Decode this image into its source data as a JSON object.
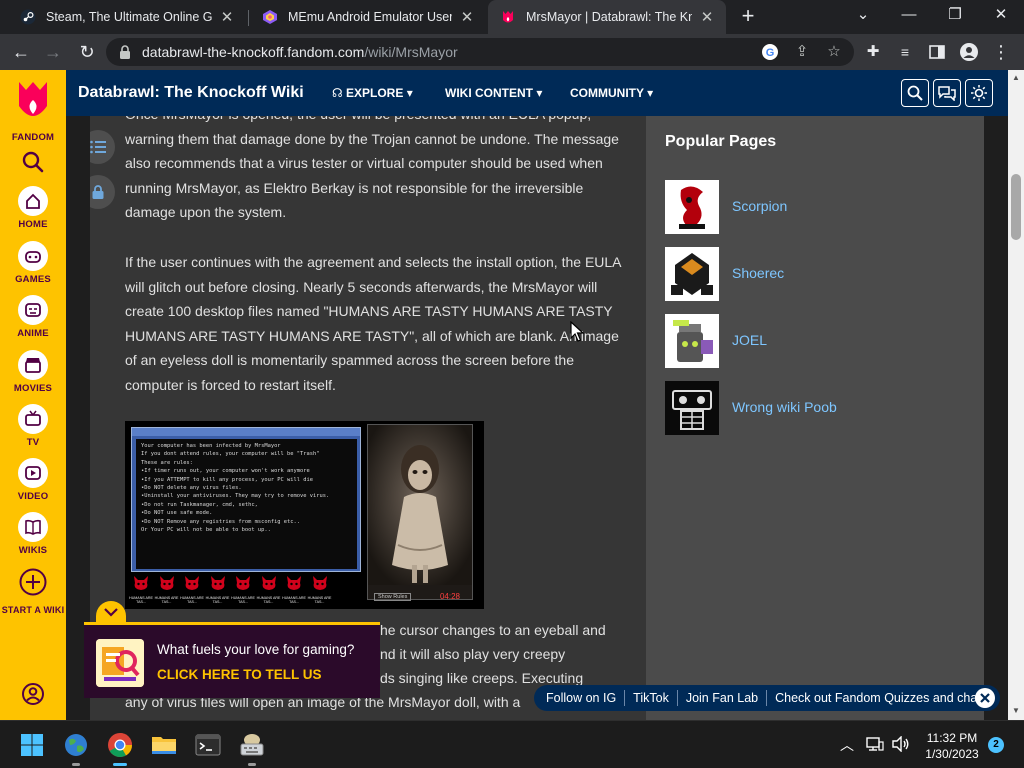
{
  "browser": {
    "tabs": [
      {
        "label": "Steam, The Ultimate Online Game",
        "active": false
      },
      {
        "label": "MEmu Android Emulator User Gu",
        "active": false
      },
      {
        "label": "MrsMayor | Databrawl: The Knock",
        "active": true
      }
    ],
    "url_host": "databrawl-the-knockoff.fandom.com",
    "url_path": "/wiki/MrsMayor"
  },
  "rail": {
    "logo_label": "FANDOM",
    "items": [
      {
        "label": "HOME",
        "icon": "home-icon"
      },
      {
        "label": "GAMES",
        "icon": "gamepad-icon"
      },
      {
        "label": "ANIME",
        "icon": "anime-icon"
      },
      {
        "label": "MOVIES",
        "icon": "clapperboard-icon"
      },
      {
        "label": "TV",
        "icon": "tv-icon"
      },
      {
        "label": "VIDEO",
        "icon": "play-icon"
      },
      {
        "label": "WIKIS",
        "icon": "book-icon"
      },
      {
        "label": "START A WIKI",
        "icon": "plus-circle-icon"
      }
    ]
  },
  "wiki_nav": {
    "title": "Databrawl: The Knockoff Wiki",
    "items": [
      "EXPLORE",
      "WIKI CONTENT",
      "COMMUNITY"
    ]
  },
  "article": {
    "paragraphs": [
      "Once MrsMayor is opened, the user will be presented with an EULA popup, warning them that damage done by the Trojan cannot be undone. The message also recommends that a virus tester or virtual computer should be used when running MrsMayor, as Elektro Berkay is not responsible for the irreversible damage upon the system.",
      "If the user continues with the agreement and selects the install option, the EULA will glitch out before closing. Nearly 5 seconds afterwards, the MrsMayor will create 100 desktop files named \"HUMANS ARE TASTY HUMANS ARE TASTY HUMANS ARE TASTY HUMANS ARE TASTY\", all of which are blank. An image of an eyeless doll is momentarily spammed across the screen before the computer is forced to restart itself."
    ],
    "partial_lines": [
      "he cursor changes to an eyeball and",
      "nd it will also play very creepy",
      "ds singing like creeps. Executing",
      "any of virus files will open an image of the MrsMayor doll, with a"
    ],
    "figure": {
      "dialog_lines": [
        "Your computer has been infected by MrsMayor",
        "If you dont attend rules, your computer will be \"Trash\"",
        "These are rules:",
        "",
        "•If timer runs out, your computer won't work anymore",
        "",
        "•If you ATTEMPT to kill any process, your PC will die",
        "",
        "•Do NOT delete any virus files.",
        "",
        "•Uninstall your antiviruses. They may try to remove virus.",
        "",
        "•Do not run Taskmanager, cmd, sethc,",
        "",
        "•Do NOT use safe mode.",
        "",
        "•Do NOT Remove any registries from msconfig etc..",
        "",
        "Or Your PC will not be able to boot up.."
      ],
      "devil_label": "HUMANS ARE TAS...",
      "show_rules_button": "Show Rules",
      "timer": "04:28"
    }
  },
  "sidebar": {
    "title": "Popular Pages",
    "items": [
      "Scorpion",
      "Shoerec",
      "JOEL",
      "Wrong wiki Poob"
    ]
  },
  "ad": {
    "question": "What fuels your love for gaming?",
    "cta": "CLICK HERE TO TELL US"
  },
  "links_bar": [
    "Follow on IG",
    "TikTok",
    "Join Fan Lab",
    "Check out Fandom Quizzes and cha"
  ],
  "taskbar": {
    "time": "11:32 PM",
    "date": "1/30/2023",
    "notifications": "2"
  },
  "colors": {
    "fandom_yellow": "#fec300",
    "nav_blue": "#002a57",
    "link_blue": "#7ec6ff"
  }
}
